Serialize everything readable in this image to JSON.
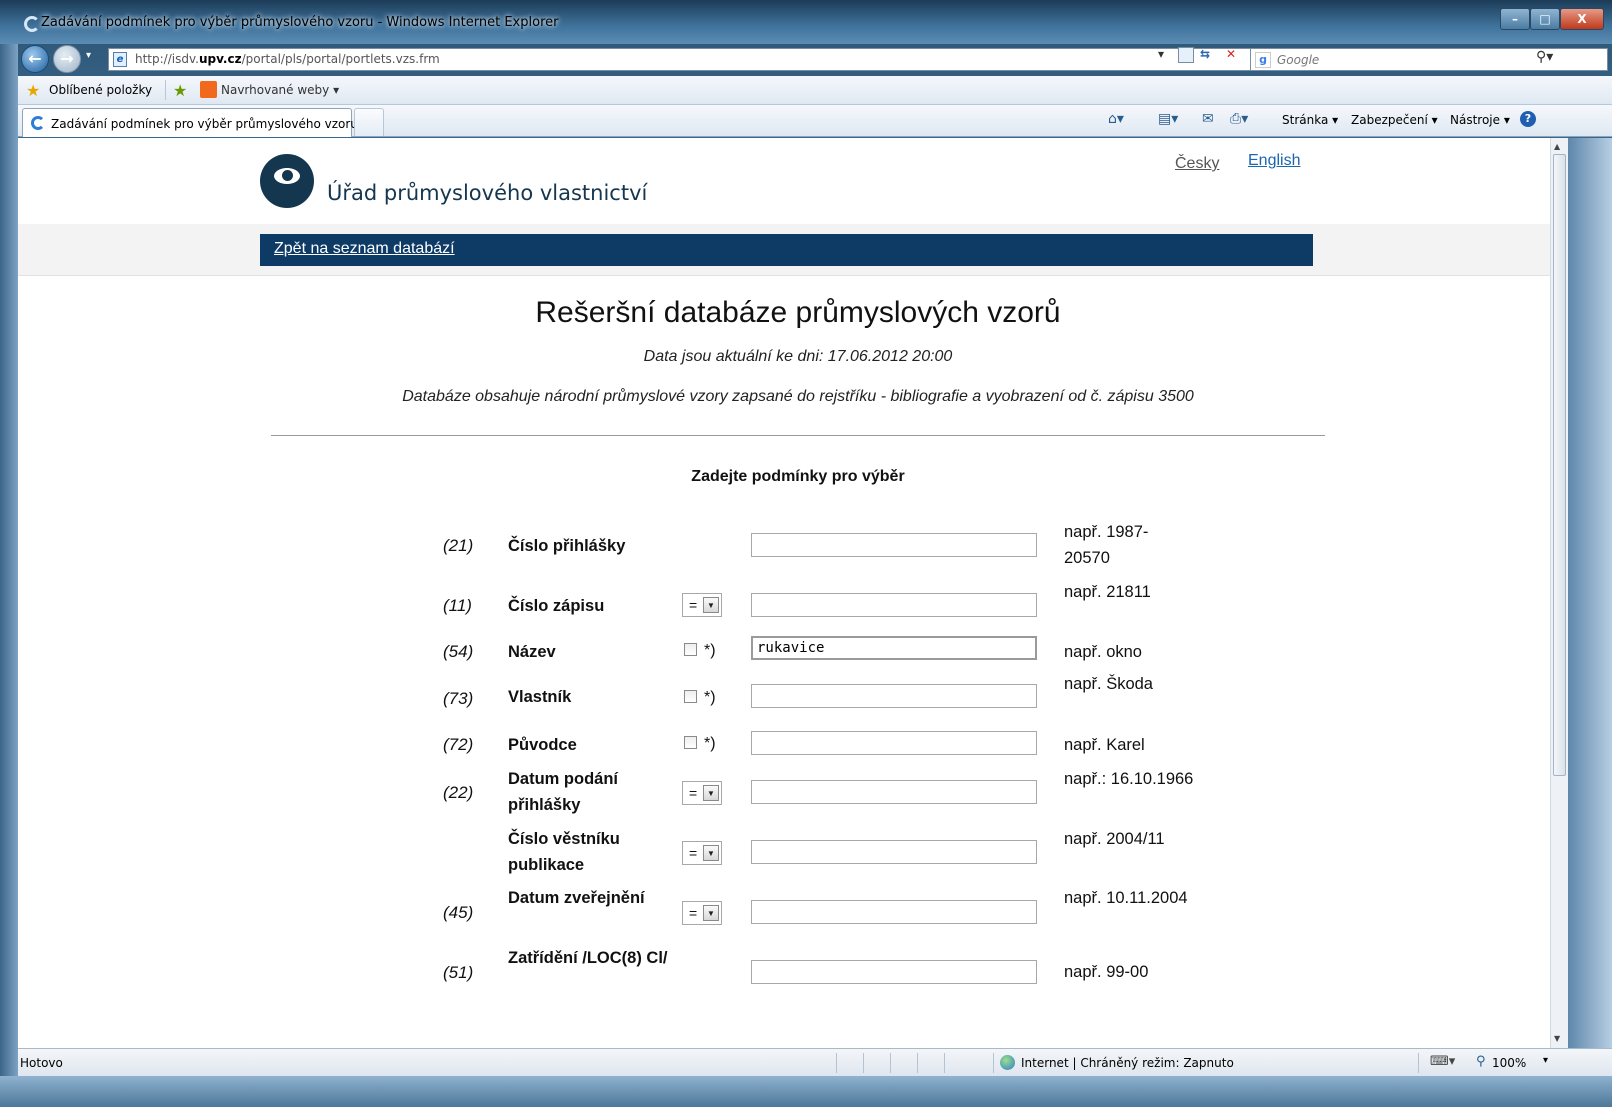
{
  "window": {
    "title": "Zadávání podmínek pro výběr průmyslového vzoru - Windows Internet Explorer",
    "controls": {
      "minimize": "–",
      "maximize": "□",
      "close": "X"
    }
  },
  "navigation": {
    "back_icon": "back-arrow-icon",
    "forward_icon": "forward-arrow-icon",
    "address_prefix": "http://isdv.",
    "address_domain": "upv.cz",
    "address_path": "/portal/pls/portal/portlets.vzs.frm",
    "search_placeholder": "Google"
  },
  "favorites_bar": {
    "favorites_label": "Oblíbené položky",
    "suggested_label": "Navrhované weby ▾"
  },
  "tabs": [
    {
      "label": "Zadávání podmínek pro výběr průmyslového vzoru",
      "active": true
    }
  ],
  "command_bar": {
    "page": "Stránka ▾",
    "safety": "Zabezpečení ▾",
    "tools": "Nástroje ▾",
    "help": "?"
  },
  "page": {
    "logo_text": "Úřad průmyslového vlastnictví",
    "lang_cz": "Česky",
    "lang_en": "English",
    "back_link": "Zpět na seznam databází",
    "title": "Rešeršní databáze průmyslových vzorů",
    "data_date": "Data jsou aktuální ke dni: 17.06.2012 20:00",
    "description": "Databáze obsahuje národní průmyslové vzory zapsané do rejstříku - bibliografie a vyobrazení od č. zápisu 3500",
    "form_heading": "Zadejte podmínky pro výběr",
    "fields": [
      {
        "code": "(21)",
        "label": "Číslo přihlášky",
        "control": "none",
        "value": "",
        "hint": "např. 1987-20570"
      },
      {
        "code": "(11)",
        "label": "Číslo zápisu",
        "control": "operator",
        "operator": "=",
        "value": "",
        "hint": "např. 21811"
      },
      {
        "code": "(54)",
        "label": "Název",
        "control": "checkbox",
        "checkbox_note": "*)",
        "checked": false,
        "value": "rukavice",
        "hint": "např. okno"
      },
      {
        "code": "(73)",
        "label": "Vlastník",
        "control": "checkbox",
        "checkbox_note": "*)",
        "checked": false,
        "value": "",
        "hint": "např. Škoda"
      },
      {
        "code": "(72)",
        "label": "Původce",
        "control": "checkbox",
        "checkbox_note": "*)",
        "checked": false,
        "value": "",
        "hint": "např. Karel"
      },
      {
        "code": "(22)",
        "label": "Datum podání přihlášky",
        "control": "operator",
        "operator": "=",
        "value": "",
        "hint": "např.: 16.10.1966"
      },
      {
        "code": "",
        "label": "Číslo věstníku publikace",
        "control": "operator",
        "operator": "=",
        "value": "",
        "hint": "např. 2004/11"
      },
      {
        "code": "(45)",
        "label": "Datum zveřejnění",
        "control": "operator",
        "operator": "=",
        "value": "",
        "hint": "např. 10.11.2004"
      },
      {
        "code": "(51)",
        "label": "Zatřídění /LOC(8) Cl/",
        "control": "none",
        "value": "",
        "hint": "např. 99-00"
      }
    ]
  },
  "status_bar": {
    "status": "Hotovo",
    "zone": "Internet | Chráněný režim: Zapnuto",
    "zoom": "100%"
  },
  "colors": {
    "nav_band": "#0e3a66",
    "link": "#1a66b0",
    "logo": "#15364f"
  }
}
